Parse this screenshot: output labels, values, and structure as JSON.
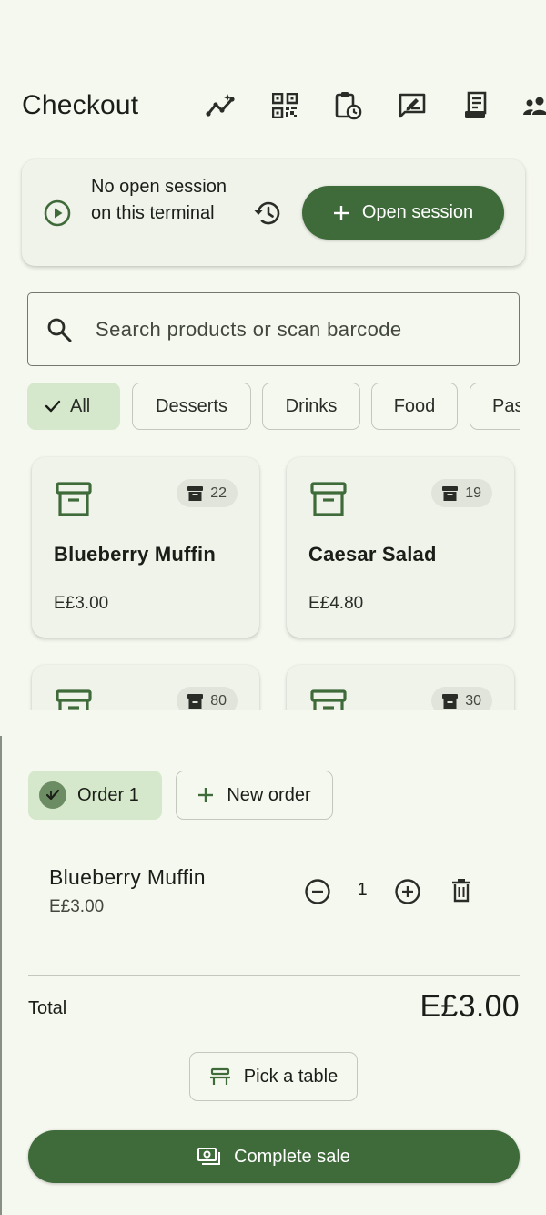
{
  "header": {
    "title": "Checkout",
    "icons": [
      "analytics-icon",
      "qr-code-icon",
      "clipboard-clock-icon",
      "signature-icon",
      "receipt-icon",
      "group-icon"
    ]
  },
  "session": {
    "status_text": "No open session on this terminal",
    "open_label": "Open session"
  },
  "search": {
    "placeholder": "Search products or scan barcode",
    "value": ""
  },
  "categories": [
    {
      "label": "All",
      "selected": true
    },
    {
      "label": "Desserts",
      "selected": false
    },
    {
      "label": "Drinks",
      "selected": false
    },
    {
      "label": "Food",
      "selected": false
    },
    {
      "label": "Pastries",
      "selected": false
    }
  ],
  "products": [
    {
      "name": "Blueberry Muffin",
      "price": "E£3.00",
      "stock": "22"
    },
    {
      "name": "Caesar Salad",
      "price": "E£4.80",
      "stock": "19"
    },
    {
      "name": "",
      "price": "",
      "stock": "80"
    },
    {
      "name": "",
      "price": "",
      "stock": "30"
    }
  ],
  "orders": {
    "active_label": "Order 1",
    "new_label": "New order"
  },
  "cart": {
    "lines": [
      {
        "name": "Blueberry Muffin",
        "price": "E£3.00",
        "qty": "1"
      }
    ],
    "total_label": "Total",
    "total_value": "E£3.00"
  },
  "actions": {
    "pick_table_label": "Pick a table",
    "complete_label": "Complete sale"
  },
  "colors": {
    "background": "#f5f8ef",
    "primary": "#3e6b39",
    "selected_chip": "#d6e8cc",
    "surface": "#f0f3ea"
  }
}
